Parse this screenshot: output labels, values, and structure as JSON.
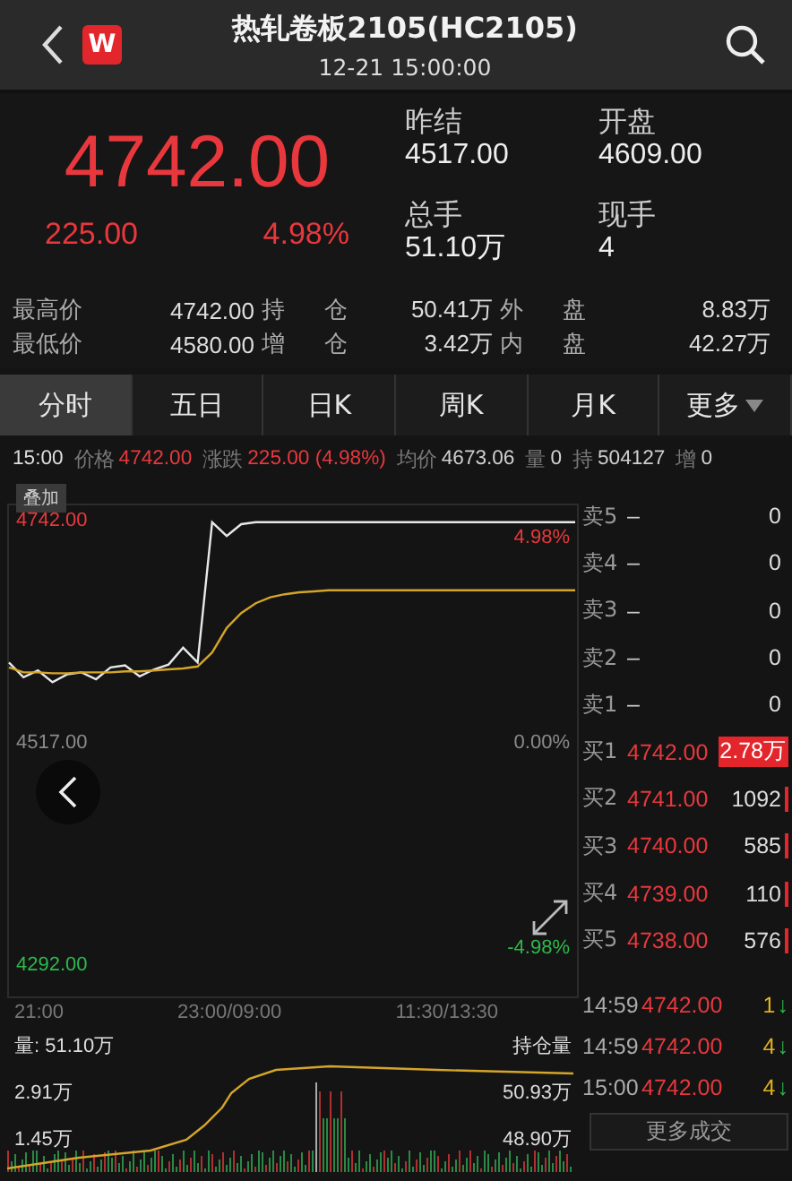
{
  "header": {
    "logo_text": "W",
    "title": "热轧卷板2105(HC2105)",
    "subtitle": "12-21 15:00:00"
  },
  "quote": {
    "price": "4742.00",
    "change": "225.00",
    "change_pct": "4.98%",
    "fields": [
      {
        "label": "昨结",
        "value": "4517.00"
      },
      {
        "label": "开盘",
        "value": "4609.00"
      },
      {
        "label": "总手",
        "value": "51.10万"
      },
      {
        "label": "现手",
        "value": "4"
      }
    ],
    "stats": [
      [
        {
          "label": "最高价",
          "value": "4742.00"
        },
        {
          "label": "持仓",
          "value": "50.41万"
        },
        {
          "label": "外盘",
          "value": "8.83万"
        }
      ],
      [
        {
          "label": "最低价",
          "value": "4580.00"
        },
        {
          "label": "增仓",
          "value": "3.42万"
        },
        {
          "label": "内盘",
          "value": "42.27万"
        }
      ]
    ]
  },
  "tabs": [
    {
      "label": "分时",
      "selected": true,
      "dropdown": false
    },
    {
      "label": "五日",
      "selected": false,
      "dropdown": false
    },
    {
      "label": "日K",
      "selected": false,
      "dropdown": false
    },
    {
      "label": "周K",
      "selected": false,
      "dropdown": false
    },
    {
      "label": "月K",
      "selected": false,
      "dropdown": false
    },
    {
      "label": "更多",
      "selected": false,
      "dropdown": true
    }
  ],
  "info_bar": {
    "time": "15:00",
    "items": [
      {
        "label": "价格",
        "value": "4742.00",
        "color": "#e8383d"
      },
      {
        "label": "涨跌",
        "value": "225.00 (4.98%)",
        "color": "#e8383d"
      },
      {
        "label": "均价",
        "value": "4673.06",
        "color": "#cfcfcf"
      },
      {
        "label": "量",
        "value": "0",
        "color": "#cfcfcf"
      },
      {
        "label": "持",
        "value": "504127",
        "color": "#cfcfcf"
      },
      {
        "label": "增",
        "value": "0",
        "color": "#cfcfcf"
      }
    ]
  },
  "chart": {
    "overlay_button": "叠加",
    "chart_data": {
      "type": "line",
      "ylim": [
        4262,
        4759
      ],
      "yticks": [
        {
          "value": 4742,
          "label": "4742.00"
        },
        {
          "value": 4517,
          "label": "4517.00"
        },
        {
          "value": 4292,
          "label": "4292.00"
        }
      ],
      "series": [
        {
          "color": "#e8e8e8",
          "values": [
            4600,
            4585,
            4592,
            4580,
            4588,
            4590,
            4583,
            4595,
            4597,
            4586,
            4593,
            4598,
            4615,
            4600,
            4742,
            4728,
            4740,
            4742,
            4742,
            4742,
            4742,
            4742,
            4742,
            4742,
            4742,
            4742,
            4742,
            4742,
            4742,
            4742,
            4742,
            4742,
            4742,
            4742,
            4742,
            4742,
            4742,
            4742,
            4742,
            4742
          ]
        },
        {
          "color": "#d4a52a",
          "values": [
            4595,
            4590,
            4590,
            4589,
            4589,
            4590,
            4590,
            4590,
            4591,
            4591,
            4592,
            4593,
            4594,
            4596,
            4610,
            4635,
            4650,
            4660,
            4666,
            4669,
            4671,
            4672,
            4673,
            4673,
            4673,
            4673,
            4673,
            4673,
            4673,
            4673,
            4673,
            4673,
            4673,
            4673,
            4673,
            4673,
            4673,
            4673,
            4673,
            4673
          ]
        }
      ]
    },
    "percent_labels": [
      {
        "text": "4.98%",
        "color": "#e8383d"
      },
      {
        "text": "0.00%",
        "color": "#8a8a8a"
      },
      {
        "text": "-4.98%",
        "color": "#2db84d"
      }
    ],
    "time_labels": [
      "21:00",
      "23:00/09:00",
      "11:30/13:30"
    ],
    "volume_label": "量: 51.10万",
    "volume_ticks": [
      "2.91万",
      "1.45万"
    ],
    "open_interest_label": "持仓量",
    "open_interest_ticks": [
      "50.93万",
      "48.90万"
    ]
  },
  "order_book": [
    {
      "kind": "sell",
      "label": "卖5",
      "price": "–",
      "volume": "0",
      "highlighted": false
    },
    {
      "kind": "sell",
      "label": "卖4",
      "price": "–",
      "volume": "0",
      "highlighted": false
    },
    {
      "kind": "sell",
      "label": "卖3",
      "price": "–",
      "volume": "0",
      "highlighted": false
    },
    {
      "kind": "sell",
      "label": "卖2",
      "price": "–",
      "volume": "0",
      "highlighted": false
    },
    {
      "kind": "sell",
      "label": "卖1",
      "price": "–",
      "volume": "0",
      "highlighted": false
    },
    {
      "kind": "buy",
      "label": "买1",
      "price": "4742.00",
      "volume": "2.78万",
      "highlighted": true
    },
    {
      "kind": "buy",
      "label": "买2",
      "price": "4741.00",
      "volume": "1092",
      "highlighted": false
    },
    {
      "kind": "buy",
      "label": "买3",
      "price": "4740.00",
      "volume": "585",
      "highlighted": false
    },
    {
      "kind": "buy",
      "label": "买4",
      "price": "4739.00",
      "volume": "110",
      "highlighted": false
    },
    {
      "kind": "buy",
      "label": "买5",
      "price": "4738.00",
      "volume": "576",
      "highlighted": false
    }
  ],
  "trades": [
    {
      "time": "14:59",
      "price": "4742.00",
      "volume": "1",
      "arrow": "↓"
    },
    {
      "time": "14:59",
      "price": "4742.00",
      "volume": "4",
      "arrow": "↓"
    },
    {
      "time": "15:00",
      "price": "4742.00",
      "volume": "4",
      "arrow": "↓"
    }
  ],
  "more_trades_button": "更多成交"
}
